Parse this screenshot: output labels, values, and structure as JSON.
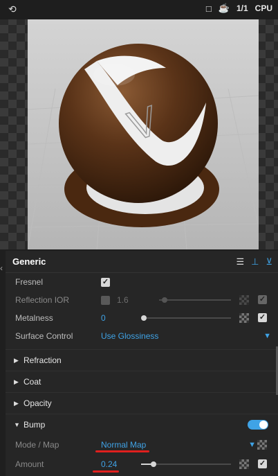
{
  "toolbar": {
    "left_icon": "render-view-icon",
    "icons": [
      "stop-icon",
      "teapot-icon"
    ],
    "ratio": "1/1",
    "engine": "CPU"
  },
  "panel": {
    "title": "Generic",
    "head_icons": [
      "sliders-icon",
      "add-layer-icon",
      "add-layer-alt-icon"
    ],
    "rows": {
      "fresnel": {
        "label": "Fresnel"
      },
      "reflection_ior": {
        "label": "Reflection IOR",
        "value": "1.6"
      },
      "metalness": {
        "label": "Metalness",
        "value": "0"
      },
      "surface_control": {
        "label": "Surface Control",
        "value": "Use Glossiness"
      }
    },
    "sections": {
      "refraction": "Refraction",
      "coat": "Coat",
      "opacity": "Opacity",
      "bump": "Bump"
    },
    "bump": {
      "mode_label": "Mode / Map",
      "mode_value": "Normal Map",
      "amount_label": "Amount",
      "amount_value": "0.24"
    }
  }
}
